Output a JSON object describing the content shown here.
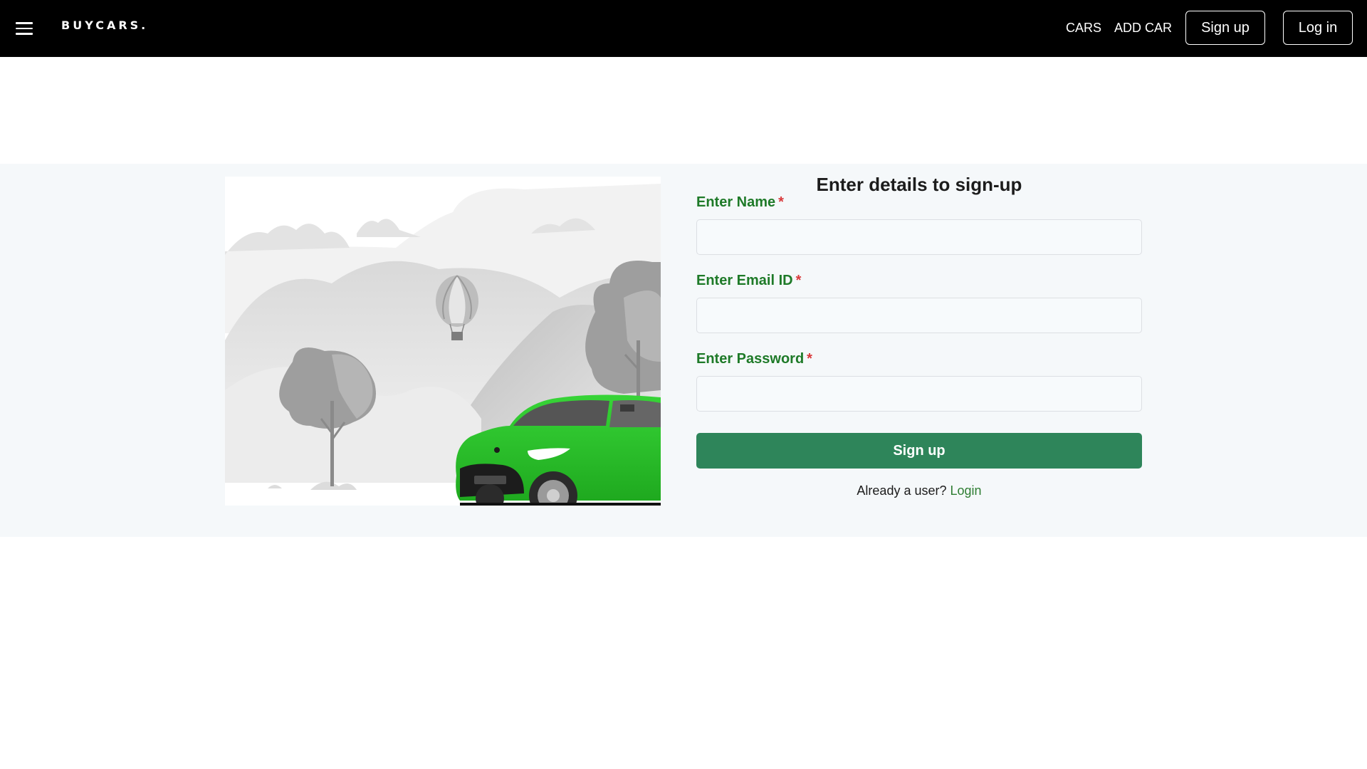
{
  "header": {
    "brand": "BUYCARS.",
    "menu_icon": "hamburger-menu-icon",
    "nav_links": {
      "cars": "CARS",
      "add_car": "ADD CAR"
    },
    "buttons": {
      "signup": "Sign up",
      "login": "Log in"
    }
  },
  "form": {
    "title": "Enter details to sign-up",
    "name_label": "Enter Name",
    "email_label": "Enter Email ID",
    "password_label": "Enter Password",
    "required_marker": "*",
    "name_value": "",
    "email_value": "",
    "password_value": "",
    "submit_label": "Sign up",
    "already_user_text": "Already a user?",
    "login_link": "Login"
  },
  "colors": {
    "header_bg": "#000000",
    "section_bg": "#f5f8fa",
    "label_green": "#1e7a28",
    "required_red": "#d9393b",
    "button_green": "#2e855a",
    "car_green": "#2ec82e"
  }
}
